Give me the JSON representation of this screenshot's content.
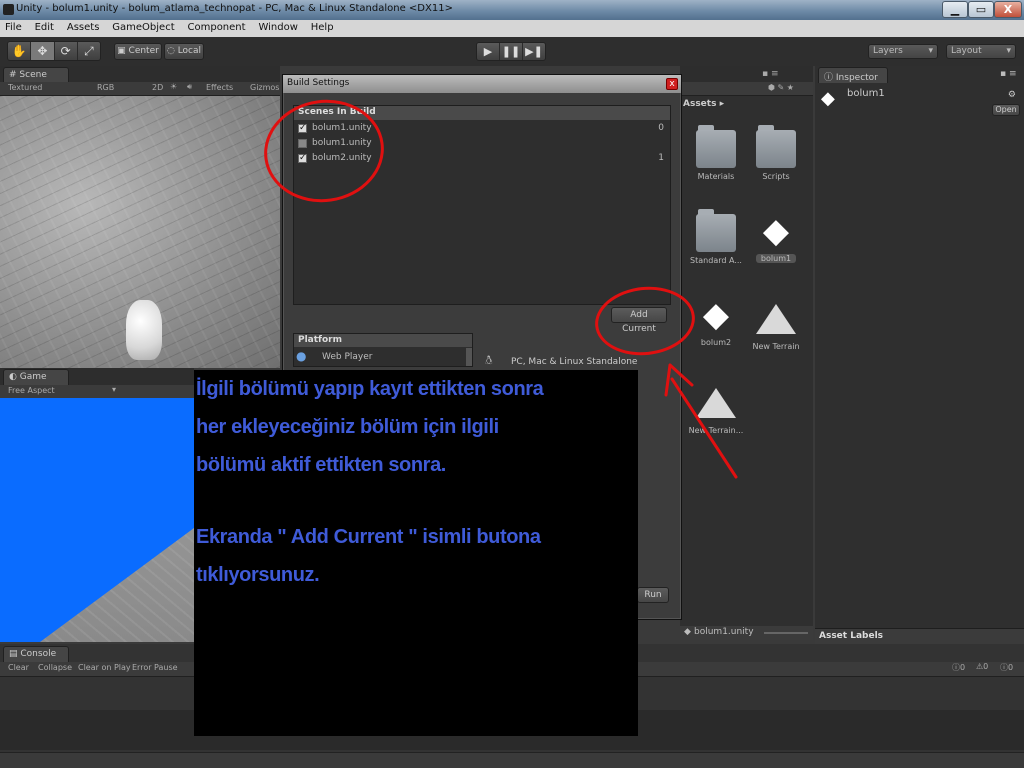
{
  "window": {
    "title": "Unity - bolum1.unity - bolum_atlama_technopat - PC, Mac & Linux Standalone <DX11>",
    "minimize": "▁",
    "maximize": "▭",
    "close": "X"
  },
  "menu": [
    "File",
    "Edit",
    "Assets",
    "GameObject",
    "Component",
    "Window",
    "Help"
  ],
  "toolbar": {
    "center": "Center",
    "local": "Local",
    "play": "▶",
    "pause": "❚❚",
    "step": "▶❚",
    "layers": "Layers",
    "layout": "Layout"
  },
  "scene": {
    "tab": "Scene",
    "textured": "Textured",
    "rgb": "RGB",
    "mode_2d": "2D",
    "effects": "Effects",
    "gizmos": "Gizmos"
  },
  "game": {
    "tab": "Game",
    "aspect": "Free Aspect"
  },
  "build_settings": {
    "title": "Build Settings",
    "close": "x",
    "scenes_header": "Scenes In Build",
    "scenes": [
      {
        "checked": true,
        "name": "bolum1.unity",
        "index": "0"
      },
      {
        "checked": false,
        "name": "bolum1.unity",
        "index": ""
      },
      {
        "checked": true,
        "name": "bolum2.unity",
        "index": "1"
      }
    ],
    "add_current": "Add Current",
    "platform_header": "Platform",
    "platform_item": "Web Player",
    "selected_platform": "PC, Mac & Linux Standalone",
    "run": "Run"
  },
  "project": {
    "header": "Assets ▸",
    "assets": [
      {
        "name": "Materials",
        "kind": "folder"
      },
      {
        "name": "Scripts",
        "kind": "folder"
      },
      {
        "name": "Standard A...",
        "kind": "folder"
      },
      {
        "name": "bolum1",
        "kind": "unity"
      },
      {
        "name": "bolum2",
        "kind": "unity"
      },
      {
        "name": "New Terrain",
        "kind": "terrain"
      },
      {
        "name": "New Terrain...",
        "kind": "terrain"
      }
    ],
    "footer": "bolum1.unity"
  },
  "inspector": {
    "tab": "Inspector",
    "object": "bolum1",
    "open": "Open",
    "asset_labels": "Asset Labels"
  },
  "console": {
    "tab": "Console",
    "clear": "Clear",
    "collapse": "Collapse",
    "clear_on_play": "Clear on Play",
    "error_pause": "Error Pause",
    "count_info": "0",
    "count_warn": "0",
    "count_err": "0"
  },
  "overlay": {
    "line1": "İlgili bölümü yapıp kayıt ettikten sonra",
    "line2": "her ekleyeceğiniz bölüm için ilgili",
    "line3": "bölümü aktif ettikten sonra.",
    "line4": "Ekranda \" Add Current \" isimli butona",
    "line5": "tıklıyorsunuz."
  },
  "colors": {
    "annotation_red": "#e01010",
    "overlay_text": "#3f5bd8",
    "game_sky": "#0a6cff"
  }
}
